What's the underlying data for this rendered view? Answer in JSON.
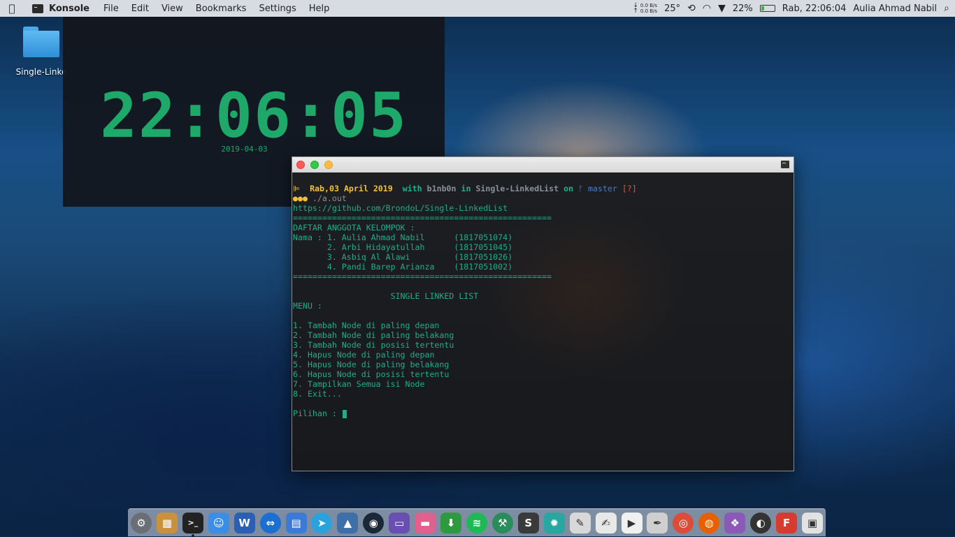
{
  "menubar": {
    "apple_icon": "apple-icon",
    "app_name": "Konsole",
    "menus": [
      "File",
      "Edit",
      "View",
      "Bookmarks",
      "Settings",
      "Help"
    ],
    "net_up": "0.0 B/s",
    "net_down": "0.0 B/s",
    "net_arrows": "↓\n↑",
    "temperature": "25°",
    "battery_percent": "22%",
    "battery_level": 0.22,
    "clock": "Rab, 22:06:04",
    "user": "Aulia Ahmad Nabil"
  },
  "desktop": {
    "folder_label": "Single-Linke"
  },
  "clock_widget": {
    "time": "22:06:05",
    "date": "2019-04-03"
  },
  "terminal": {
    "prompt": {
      "marker": "⊫",
      "date": "Rab,03 April 2019",
      "with": "with",
      "user": "b1nb0n",
      "in": "in",
      "dir": "Single-LinkedList",
      "on": "on",
      "branch": "ᚠ master",
      "status": "[?]"
    },
    "cmd_dots": "●●●",
    "command": "./a.out",
    "lines": [
      "https://github.com/BrondoL/Single-LinkedList",
      "=====================================================",
      "DAFTAR ANGGOTA KELOMPOK :",
      "Nama : 1. Aulia Ahmad Nabil      (1817051074)",
      "       2. Arbi Hidayatullah      (1817051045)",
      "       3. Asbiq Al Alawi         (1817051026)",
      "       4. Pandi Barep Arianza    (1817051002)",
      "=====================================================",
      "",
      "                    SINGLE LINKED LIST",
      "MENU :",
      "",
      "1. Tambah Node di paling depan",
      "2. Tambah Node di paling belakang",
      "3. Tambah Node di posisi tertentu",
      "4. Hapus Node di paling depan",
      "5. Hapus Node di paling belakang",
      "6. Hapus Node di posisi tertentu",
      "7. Tampilkan Semua isi Node",
      "8. Exit...",
      ""
    ],
    "input_prompt": "Pilihan : "
  },
  "dock": {
    "apps": [
      {
        "name": "system-preferences-icon",
        "glyph": "⚙",
        "color": "#6b6f75",
        "round": true
      },
      {
        "name": "archive-icon",
        "glyph": "▦",
        "color": "#c9913c",
        "round": false
      },
      {
        "name": "terminal-icon",
        "glyph": ">_",
        "color": "#222222",
        "round": false,
        "running": true
      },
      {
        "name": "finder-icon",
        "glyph": "☺",
        "color": "#3a8ee6",
        "round": false
      },
      {
        "name": "word-icon",
        "glyph": "W",
        "color": "#2b5fb3",
        "round": false
      },
      {
        "name": "teamviewer-icon",
        "glyph": "⇔",
        "color": "#1b6fd1",
        "round": true
      },
      {
        "name": "file-manager-icon",
        "glyph": "▤",
        "color": "#3b7bd6",
        "round": false
      },
      {
        "name": "telegram-icon",
        "glyph": "➤",
        "color": "#2aa3dd",
        "round": true
      },
      {
        "name": "image-viewer-icon",
        "glyph": "▲",
        "color": "#3d6fa8",
        "round": false
      },
      {
        "name": "steam-icon",
        "glyph": "◉",
        "color": "#1b2838",
        "round": true
      },
      {
        "name": "game-emulator-icon",
        "glyph": "▭",
        "color": "#6a4fb3",
        "round": false
      },
      {
        "name": "folder-pink-icon",
        "glyph": "▬",
        "color": "#e0608e",
        "round": false
      },
      {
        "name": "download-icon",
        "glyph": "⬇",
        "color": "#2e9a3f",
        "round": false
      },
      {
        "name": "spotify-icon",
        "glyph": "≋",
        "color": "#1db954",
        "round": true
      },
      {
        "name": "xcode-icon",
        "glyph": "⚒",
        "color": "#2a8c5a",
        "round": true
      },
      {
        "name": "sublime-text-icon",
        "glyph": "S",
        "color": "#3a3a3a",
        "round": false
      },
      {
        "name": "pineapple-icon",
        "glyph": "✹",
        "color": "#27a7a0",
        "round": false
      },
      {
        "name": "notes-icon",
        "glyph": "✎",
        "color": "#d8d8d8",
        "round": false
      },
      {
        "name": "text-edit-icon",
        "glyph": "✍",
        "color": "#e8e8e8",
        "round": false
      },
      {
        "name": "prompt-icon",
        "glyph": "▶",
        "color": "#f0f0f0",
        "round": false
      },
      {
        "name": "script-editor-icon",
        "glyph": "✒",
        "color": "#cfcfcf",
        "round": false
      },
      {
        "name": "chrome-icon",
        "glyph": "◎",
        "color": "#dd4b39",
        "round": true
      },
      {
        "name": "firefox-icon",
        "glyph": "◍",
        "color": "#e66000",
        "round": true
      },
      {
        "name": "color-picker-icon",
        "glyph": "❖",
        "color": "#8b5ab8",
        "round": false
      },
      {
        "name": "disk-utility-icon",
        "glyph": "◐",
        "color": "#333333",
        "round": true
      },
      {
        "name": "foxit-reader-icon",
        "glyph": "F",
        "color": "#d63b2f",
        "round": false
      },
      {
        "name": "photo-booth-icon",
        "glyph": "▣",
        "color": "#e2e2e2",
        "round": false
      }
    ]
  }
}
